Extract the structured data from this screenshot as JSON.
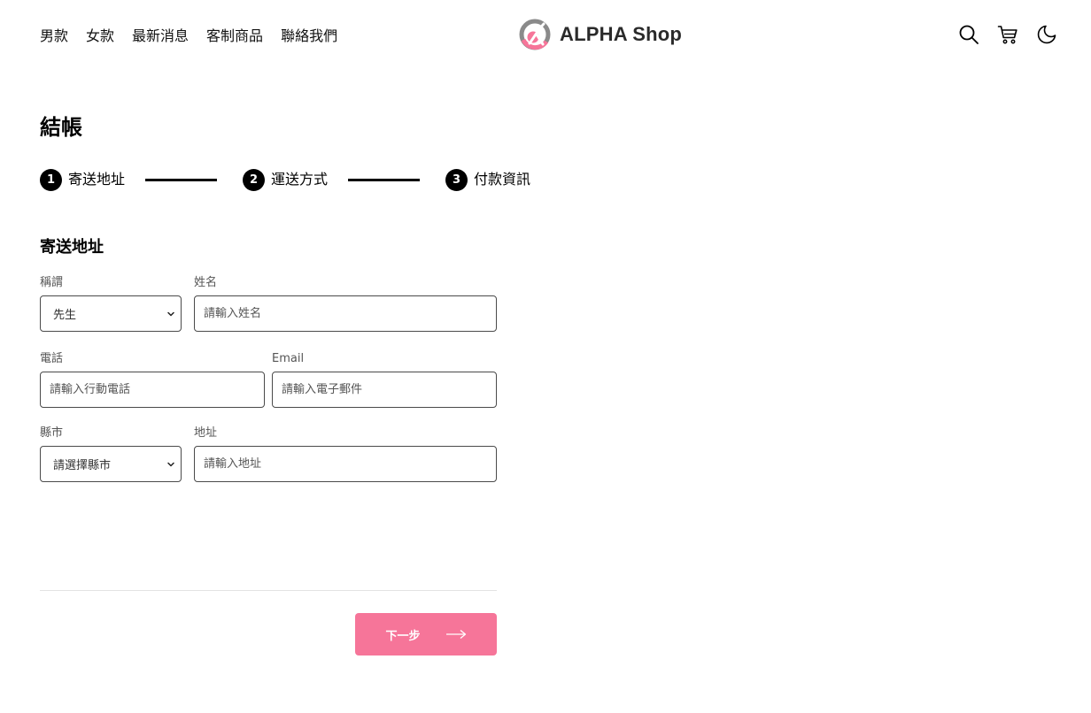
{
  "header": {
    "nav": [
      "男款",
      "女款",
      "最新消息",
      "客制商品",
      "聯絡我們"
    ],
    "logo_text": "ALPHA Shop",
    "icons": [
      "search-icon",
      "cart-icon",
      "moon-icon"
    ],
    "accent_color": "#f67599"
  },
  "main": {
    "title": "結帳",
    "steps": [
      {
        "number": "1",
        "label": "寄送地址"
      },
      {
        "number": "2",
        "label": "運送方式"
      },
      {
        "number": "3",
        "label": "付款資訊"
      }
    ],
    "section_title": "寄送地址",
    "form": {
      "salutation": {
        "label": "稱謂",
        "value": "先生"
      },
      "name": {
        "label": "姓名",
        "placeholder": "請輸入姓名"
      },
      "phone": {
        "label": "電話",
        "placeholder": "請輸入行動電話"
      },
      "email": {
        "label": "Email",
        "placeholder": "請輸入電子郵件"
      },
      "city": {
        "label": "縣市",
        "value": "請選擇縣市"
      },
      "address": {
        "label": "地址",
        "placeholder": "請輸入地址"
      }
    },
    "next_button": "下一步"
  }
}
